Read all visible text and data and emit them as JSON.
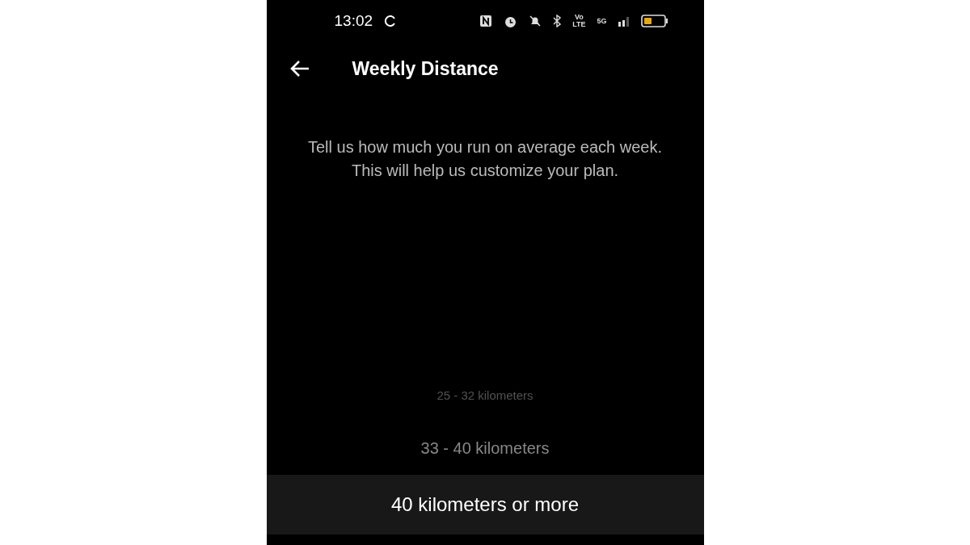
{
  "status_bar": {
    "time": "13:02",
    "volte": "Vo LTE",
    "network": "5G"
  },
  "header": {
    "title": "Weekly Distance"
  },
  "description": "Tell us how much you run on average each week.\nThis will help us customize your plan.",
  "picker": {
    "options": [
      {
        "label": "25 - 32 kilometers",
        "selected": false
      },
      {
        "label": "33 - 40 kilometers",
        "selected": false
      },
      {
        "label": "40 kilometers or more",
        "selected": true
      }
    ]
  }
}
